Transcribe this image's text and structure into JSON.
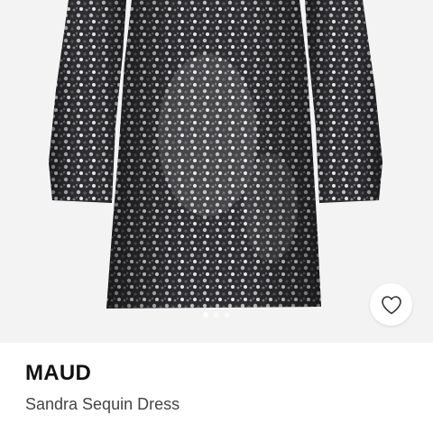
{
  "product": {
    "brand": "MAUD",
    "name": "Sandra Sequin Dress",
    "image_alt": "Sandra Sequin Dress"
  },
  "gallery": {
    "image_count": 5,
    "active_index": 0
  },
  "icons": {
    "favorite": "heart-outline-icon"
  },
  "colors": {
    "image_background": "#f3f3f3",
    "brand_text": "#111111",
    "name_text": "#444444",
    "sequin_dark": "#2b2b2e",
    "sequin_light": "#d8d8dc"
  }
}
